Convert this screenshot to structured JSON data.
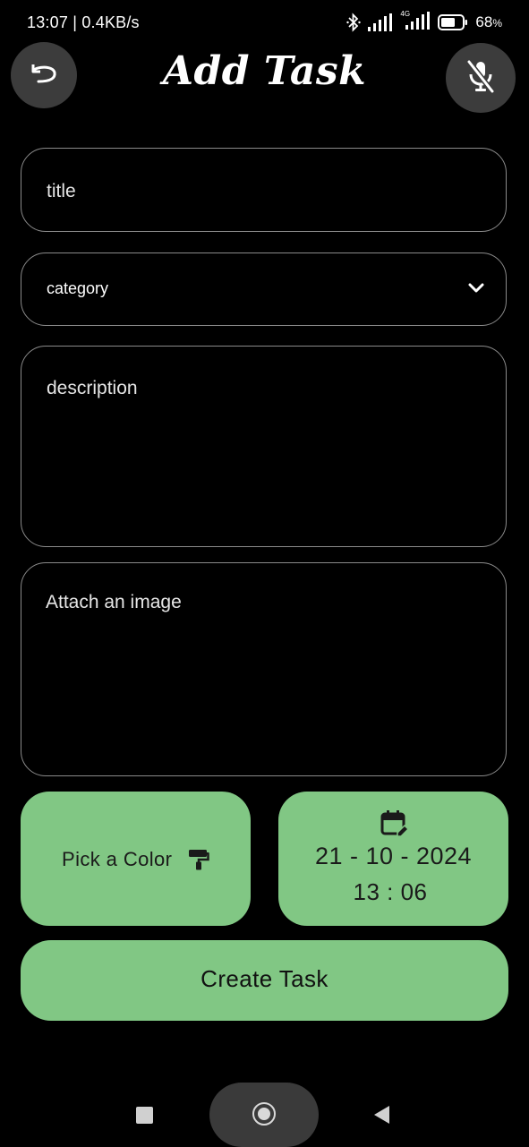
{
  "status_bar": {
    "time_speed": "13:07 | 0.4KB/s",
    "network_label": "4G",
    "battery_percent": "68",
    "battery_suffix": "%",
    "battery_level": 0.68,
    "icons": [
      "bluetooth-icon",
      "signal-icon",
      "signal-4g-icon",
      "battery-icon"
    ]
  },
  "header": {
    "title": "Add Task",
    "back_icon": "undo-arrow-icon",
    "mic_icon": "mic-off-icon"
  },
  "form": {
    "title_placeholder": "title",
    "category_placeholder": "category",
    "category_icon": "chevron-down-icon",
    "description_placeholder": "description",
    "image_placeholder": "Attach an image"
  },
  "actions": {
    "pick_color_label": "Pick a Color",
    "pick_color_icon": "paint-roller-icon",
    "date_icon": "calendar-edit-icon",
    "date": "21 - 10 - 2024",
    "time": "13 : 06",
    "create_label": "Create Task",
    "accent_color": "#81c784"
  },
  "nav_bar": {
    "recents_icon": "square-icon",
    "home_icon": "home-circle-icon",
    "back_icon": "triangle-back-icon"
  }
}
